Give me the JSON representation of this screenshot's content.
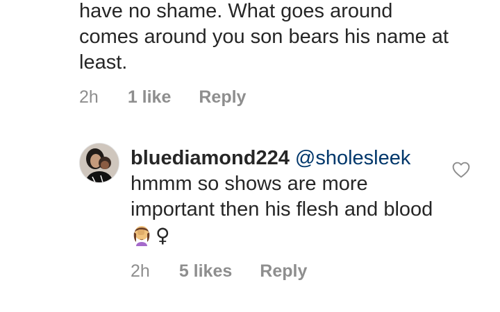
{
  "parent_comment": {
    "text": "have no shame. What goes around comes around you son bears his name at least.",
    "time": "2h",
    "likes": "1 like",
    "reply_label": "Reply"
  },
  "reply_comment": {
    "username": "bluediamond224",
    "mention": "@sholesleek",
    "text": "hmmm so shows are more important then his flesh and blood",
    "emoji": "woman-facepalming-icon",
    "female_sign": "♀",
    "time": "2h",
    "likes": "5 likes",
    "reply_label": "Reply"
  },
  "icons": {
    "like": "heart-outline-icon",
    "avatar": "user-avatar"
  },
  "colors": {
    "text": "#262626",
    "muted": "#8e8e8e",
    "mention": "#00376b"
  }
}
